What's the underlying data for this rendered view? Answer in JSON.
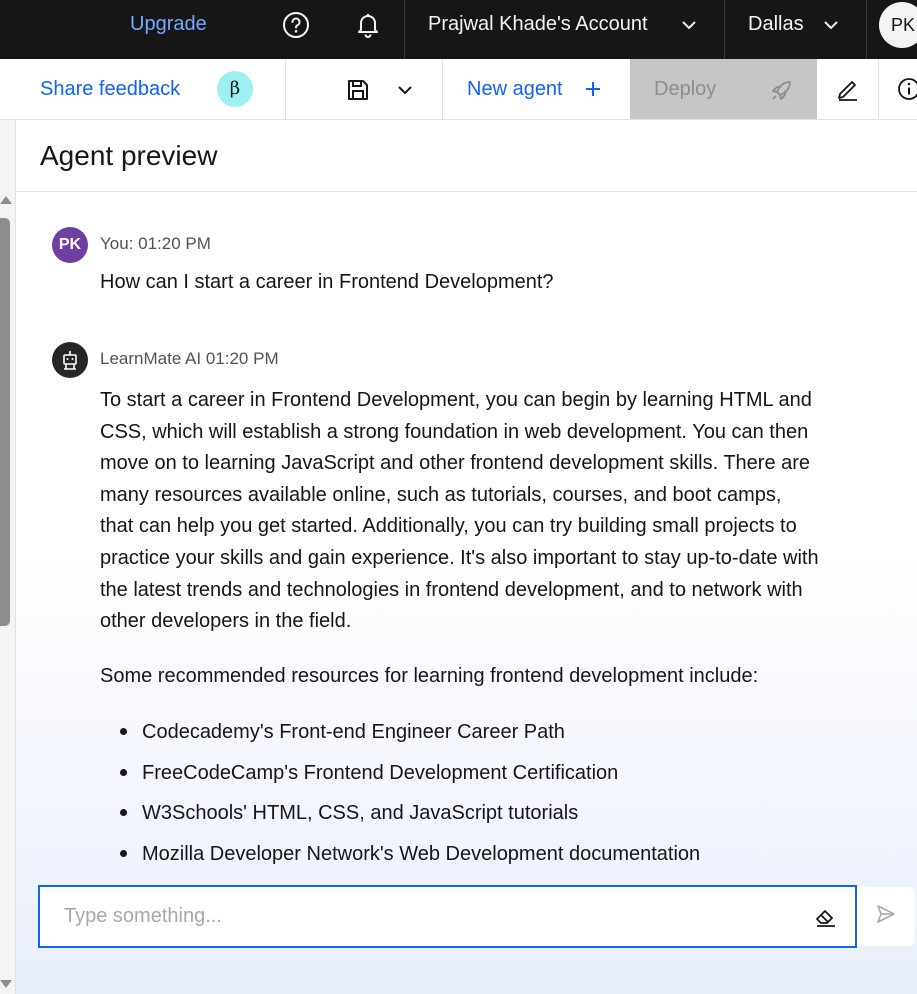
{
  "topbar": {
    "upgrade_label": "Upgrade",
    "account_label": "Prajwal Khade's Account",
    "region_label": "Dallas",
    "avatar_initials": "PK"
  },
  "toolbar": {
    "feedback_label": "Share feedback",
    "beta_badge": "β",
    "new_agent_label": "New agent",
    "deploy_label": "Deploy"
  },
  "panel": {
    "title": "Agent preview"
  },
  "chat": {
    "user": {
      "avatar_initials": "PK",
      "meta": "You: 01:20 PM",
      "text": "How can I start a career in Frontend Development?"
    },
    "bot": {
      "meta": "LearnMate AI 01:20 PM",
      "paragraph": "To start a career in Frontend Development, you can begin by learning HTML and CSS, which will establish a strong foundation in web development. You can then move on to learning JavaScript and other frontend development skills. There are many resources available online, such as tutorials, courses, and boot camps, that can help you get started. Additionally, you can try building small projects to practice your skills and gain experience. It's also important to stay up-to-date with the latest trends and technologies in frontend development, and to network with other developers in the field.",
      "intro": "Some recommended resources for learning frontend development include:",
      "resources": [
        "Codecademy's Front-end Engineer Career Path",
        "FreeCodeCamp's Frontend Development Certification",
        "W3Schools' HTML, CSS, and JavaScript tutorials",
        "Mozilla Developer Network's Web Development documentation"
      ]
    }
  },
  "input": {
    "placeholder": "Type something...",
    "value": ""
  },
  "colors": {
    "topbar_bg": "#161616",
    "link_blue": "#0f62fe",
    "upgrade_blue": "#78a9ff",
    "beta_badge_bg": "#9ef0f0",
    "user_avatar_bg": "#6e3fa3",
    "deploy_disabled_bg": "#c6c6c6"
  },
  "icons": {
    "help": "help-icon",
    "notifications": "bell-icon",
    "save": "save-icon",
    "add": "plus-icon",
    "deploy": "rocket-icon",
    "edit": "pencil-icon",
    "info": "info-icon",
    "bot_avatar": "robot-icon",
    "clear": "eraser-icon",
    "send": "send-icon"
  }
}
